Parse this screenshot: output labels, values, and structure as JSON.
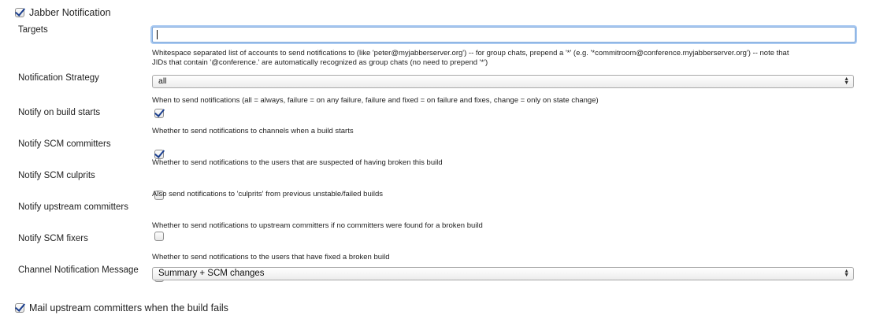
{
  "jabber": {
    "enabled": true,
    "title": "Jabber Notification"
  },
  "targets": {
    "label": "Targets",
    "value": "",
    "placeholder": "",
    "help_line1": "Whitespace separated list of accounts to send notifications to (like 'peter@myjabberserver.org') -- for group chats, prepend a '*' (e.g. '*commitroom@conference.myjabberserver.org') -- note that",
    "help_line2": "JIDs that contain '@conference.' are automatically recognized as group chats (no need to prepend '*')"
  },
  "strategy": {
    "label": "Notification Strategy",
    "selected": "all",
    "help": "When to send notifications (all = always, failure = on any failure, failure and fixed = on failure and fixes, change = only on state change)"
  },
  "options": [
    {
      "label": "Notify on build starts",
      "checked": true,
      "help": "Whether to send notifications to channels when a build starts"
    },
    {
      "label": "Notify SCM committers",
      "checked": true,
      "help": "Whether to send notifications to the users that are suspected of having broken this build"
    },
    {
      "label": "Notify SCM culprits",
      "checked": false,
      "help": "Also send notifications to 'culprits' from previous unstable/failed builds"
    },
    {
      "label": "Notify upstream committers",
      "checked": false,
      "help": "Whether to send notifications to upstream committers if no committers were found for a broken build"
    },
    {
      "label": "Notify SCM fixers",
      "checked": false,
      "help": "Whether to send notifications to the users that have fixed a broken build"
    }
  ],
  "channel_message": {
    "label": "Channel Notification Message",
    "selected": "Summary + SCM changes"
  },
  "mail_upstream": {
    "enabled": true,
    "title": "Mail upstream committers when the build fails"
  }
}
